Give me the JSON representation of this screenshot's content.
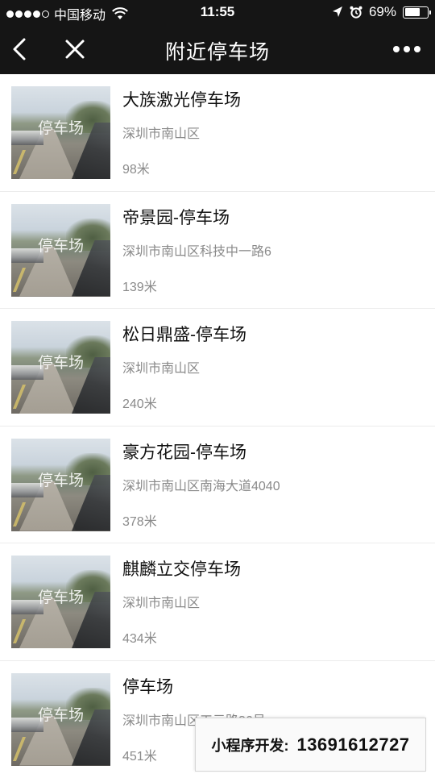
{
  "status_bar": {
    "carrier": "中国移动",
    "time": "11:55",
    "battery_percent": "69%",
    "battery_level": 0.69,
    "signal_dots_filled": 4,
    "icons": [
      "signal-dots-icon",
      "wifi-icon",
      "location-arrow-icon",
      "alarm-icon",
      "battery-icon"
    ]
  },
  "nav": {
    "title": "附近停车场",
    "icons": [
      "back-chevron-icon",
      "close-icon",
      "more-dots-icon"
    ]
  },
  "parking_list": [
    {
      "name": "大族激光停车场",
      "address": "深圳市南山区",
      "distance": "98米",
      "thumb_watermark": "停车场"
    },
    {
      "name": "帝景园-停车场",
      "address": "深圳市南山区科技中一路6",
      "distance": "139米",
      "thumb_watermark": "停车场"
    },
    {
      "name": "松日鼎盛-停车场",
      "address": "深圳市南山区",
      "distance": "240米",
      "thumb_watermark": "停车场"
    },
    {
      "name": "豪方花园-停车场",
      "address": "深圳市南山区南海大道4040",
      "distance": "378米",
      "thumb_watermark": "停车场"
    },
    {
      "name": "麒麟立交停车场",
      "address": "深圳市南山区",
      "distance": "434米",
      "thumb_watermark": "停车场"
    },
    {
      "name": "停车场",
      "address": "深圳市南山区工元路36号",
      "distance": "451米",
      "thumb_watermark": "停车场"
    }
  ],
  "promo": {
    "label": "小程序开发:",
    "phone": "13691612727"
  },
  "colors": {
    "bar_background": "#151515",
    "title_text": "#111111",
    "secondary_text": "#8a8a8a",
    "divider": "#ececec"
  }
}
